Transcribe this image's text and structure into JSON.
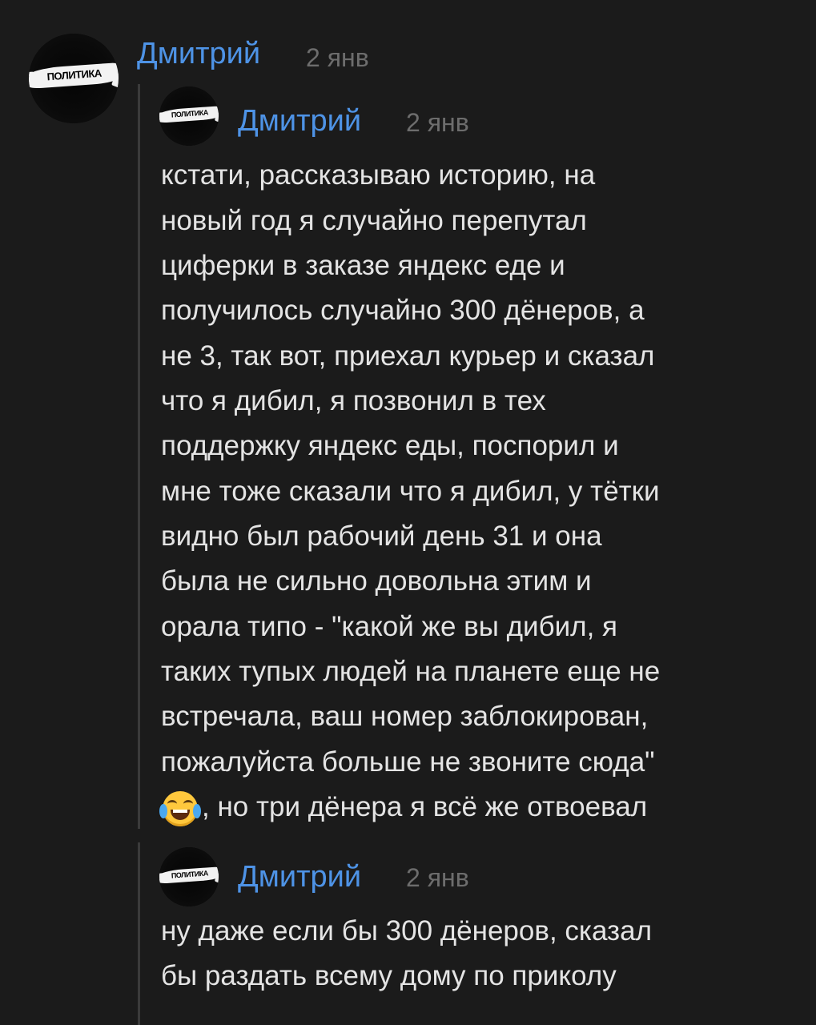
{
  "comments": [
    {
      "author": "Дмитрий",
      "date": "2 янв",
      "avatar_text": "ПОЛИТИКА"
    },
    {
      "author": "Дмитрий",
      "date": "2 янв",
      "avatar_text": "ПОЛИТИКА",
      "text_lines": [
        "кстати, рассказываю историю, на",
        "новый год я случайно перепутал",
        "циферки в заказе яндекс еде и",
        "получилось случайно 300 дёнеров, а",
        "не 3, так вот, приехал курьер и сказал",
        "что я дибил, я позвонил в тех",
        "поддержку яндекс еды, поспорил и",
        "мне тоже сказали что я дибил, у тётки",
        "видно был рабочий день 31 и она",
        "была не сильно довольна этим и",
        "орала типо - \"какой же вы дибил, я",
        "таких тупых людей на планете еще не",
        "встречала, ваш номер заблокирован,",
        "пожалуйста больше не звоните сюда\"",
        ", но три дёнера я всё же отвоевал"
      ],
      "emoji": "face-with-tears-of-joy"
    },
    {
      "author": "Дмитрий",
      "date": "2 янв",
      "avatar_text": "ПОЛИТИКА",
      "text_lines": [
        "ну даже если бы 300 дёнеров, сказал",
        "бы раздать всему дому по приколу"
      ]
    }
  ],
  "colors": {
    "background": "#1b1b1b",
    "author": "#4e93e6",
    "date": "#6d6d6d",
    "text": "#e4e4e4",
    "thread_line": "#3b3b3b"
  }
}
